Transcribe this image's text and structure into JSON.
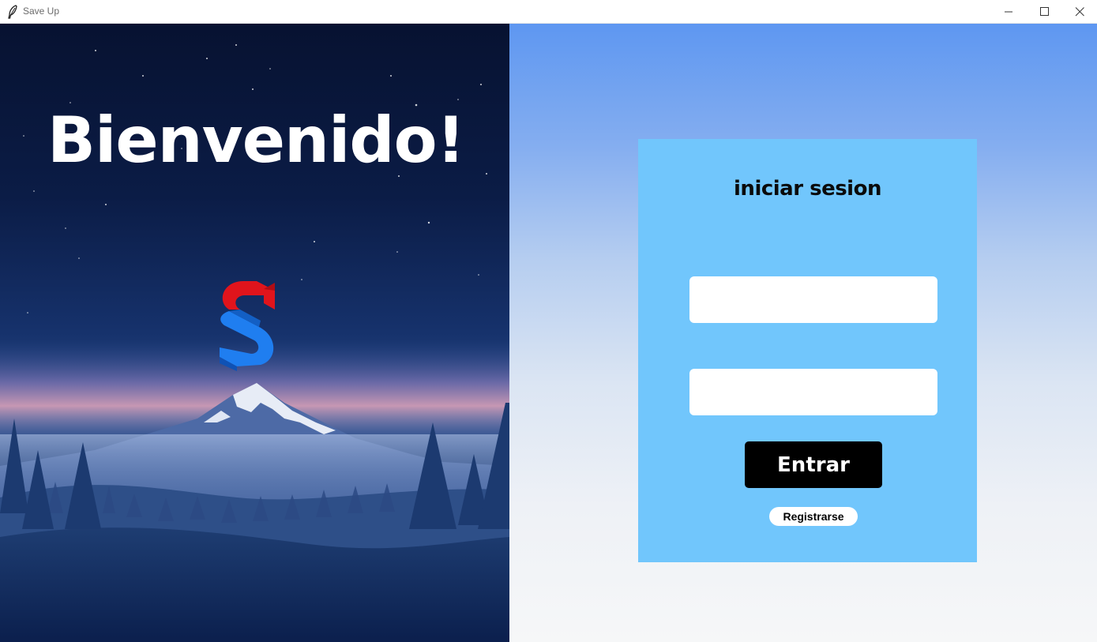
{
  "window": {
    "title": "Save Up",
    "icons": {
      "app": "feather-icon",
      "minimize": "minimize-icon",
      "maximize": "maximize-icon",
      "close": "close-icon"
    }
  },
  "left": {
    "welcome": "Bienvenido!",
    "logo_icon": "save-up-logo-icon",
    "colors": {
      "logo_red": "#e0141c",
      "logo_blue": "#1f7ef0"
    }
  },
  "login": {
    "title": "iniciar sesion",
    "username_value": "",
    "password_value": "",
    "enter_label": "Entrar",
    "register_label": "Registrarse"
  },
  "colors": {
    "card": "#71c6fc",
    "button": "#000000",
    "gradient_top": "#5e97f1",
    "gradient_bottom": "#f6f7f8"
  }
}
